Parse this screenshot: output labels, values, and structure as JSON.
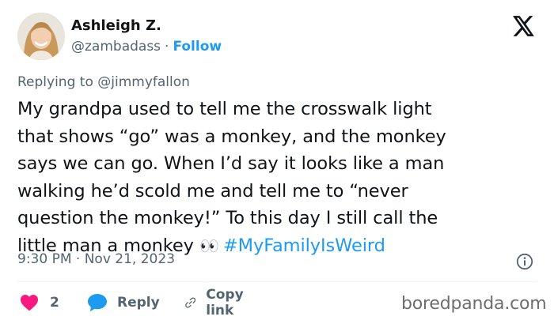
{
  "author": {
    "name": "Ashleigh Z.",
    "handle": "@zambadass",
    "separator": "·",
    "follow_label": "Follow"
  },
  "reply_context": {
    "prefix": "Replying to",
    "handle": "@jimmyfallon"
  },
  "tweet": {
    "lines": [
      "My grandpa used to tell me the crosswalk light",
      "that shows “go” was a monkey, and the monkey",
      "says we can go. When I’d say it looks like a man",
      "walking he’d scold me and tell me to “never",
      "question the monkey!” To this day I still call the"
    ],
    "last_line_text": "little man a monkey",
    "emoji": "👀",
    "hashtag": "#MyFamilyIsWeird"
  },
  "meta": {
    "time": "9:30 PM",
    "separator": "·",
    "date": "Nov 21, 2023"
  },
  "actions": {
    "like_count": "2",
    "reply_label": "Reply",
    "copy_label": "Copy link"
  },
  "watermark": "boredpanda.com",
  "colors": {
    "accent": "#1d9bf0",
    "like": "#f91880",
    "text": "#0f1419",
    "secondary": "#536471"
  },
  "icons": [
    "x-logo-icon",
    "eyes-emoji-icon",
    "info-icon",
    "heart-icon",
    "reply-bubble-icon",
    "link-icon"
  ]
}
